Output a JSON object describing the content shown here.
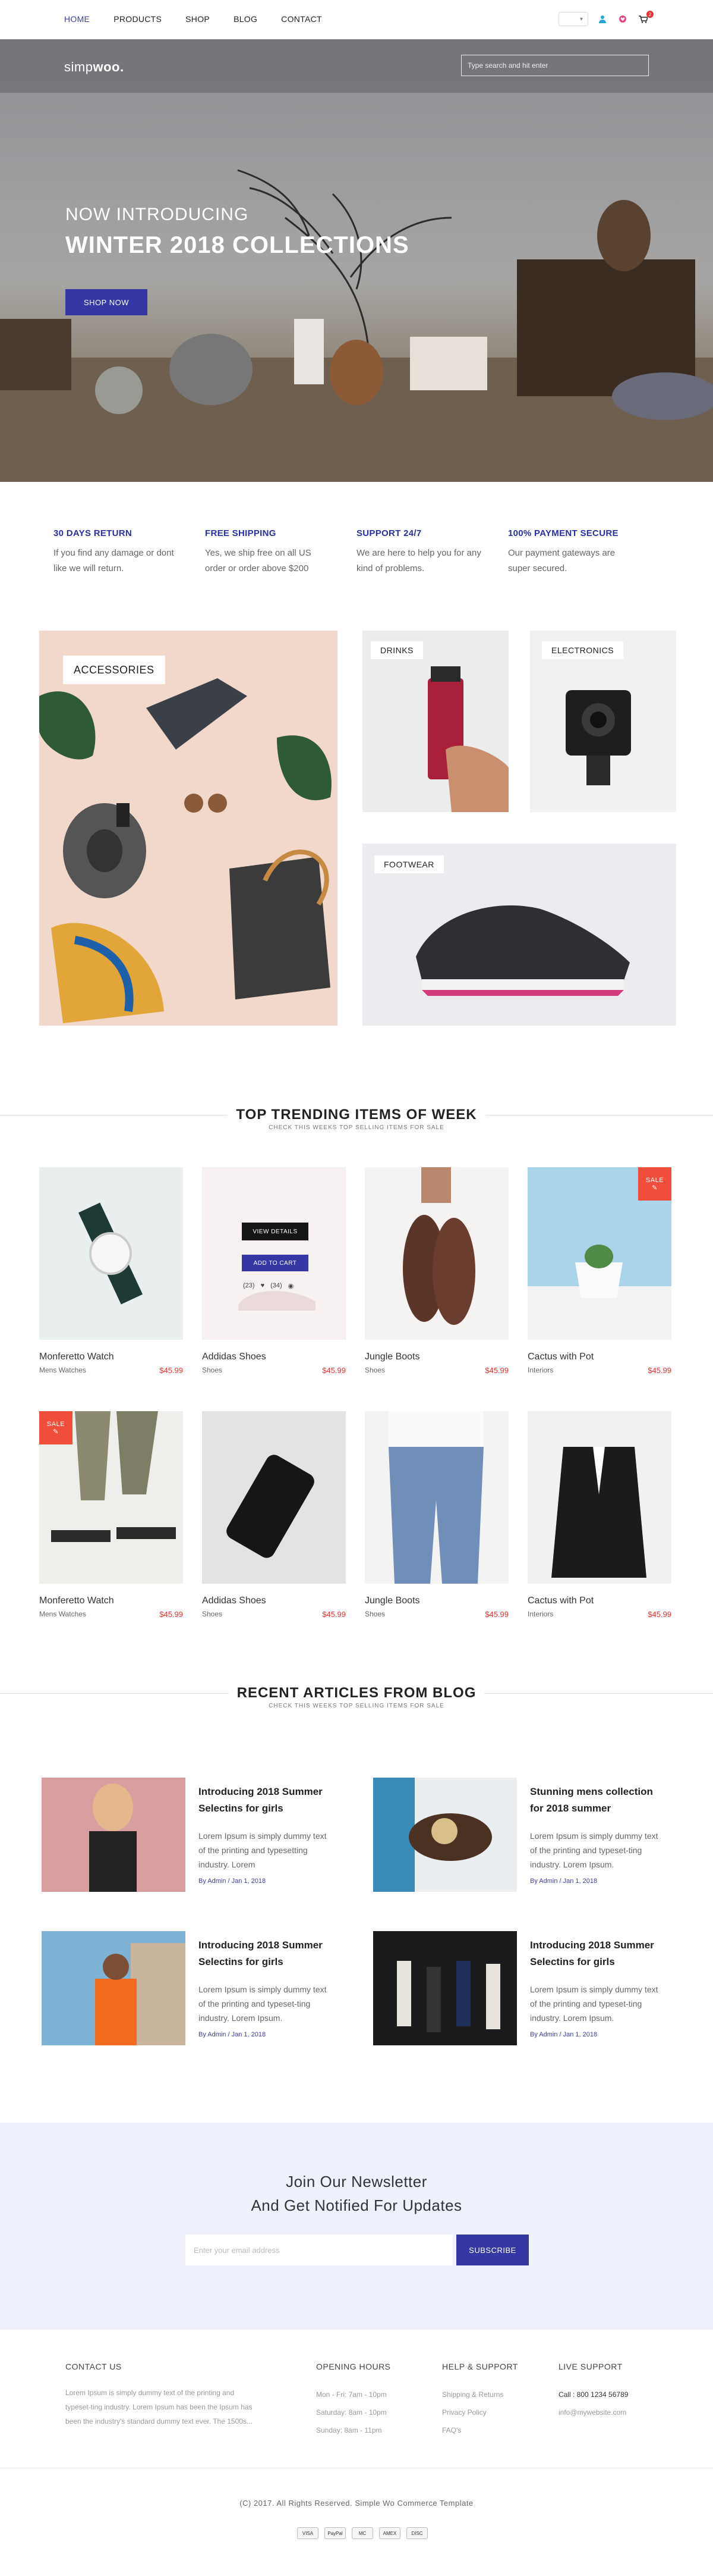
{
  "nav": {
    "items": [
      "HOME",
      "PRODUCTS",
      "SHOP",
      "BLOG",
      "CONTACT"
    ],
    "cart_count": "2"
  },
  "hero": {
    "logo_prefix": "simp",
    "logo_bold": "woo.",
    "search_placeholder": "Type search and hit enter",
    "kicker": "NOW INTRODUCING",
    "headline": "WINTER 2018 COLLECTIONS",
    "cta": "SHOP NOW"
  },
  "features": [
    {
      "title": "30 DAYS RETURN",
      "text": "If you find any damage or dont like we will return."
    },
    {
      "title": "FREE SHIPPING",
      "text": "Yes, we ship free on all US order or order above $200"
    },
    {
      "title": "SUPPORT 24/7",
      "text": "We are here to help you for any kind of problems."
    },
    {
      "title": "100% PAYMENT SECURE",
      "text": "Our payment gateways are super secured."
    }
  ],
  "categories": {
    "accessories": "ACCESSORIES",
    "drinks": "DRINKS",
    "electronics": "ELECTRONICS",
    "footwear": "FOOTWEAR"
  },
  "trending": {
    "title": "TOP TRENDING ITEMS OF WEEK",
    "subtitle": "CHECK THIS WEEKS TOP SELLING ITEMS FOR SALE",
    "view_details": "VIEW DETAILS",
    "add_to_cart": "ADD TO CART",
    "likes": "(23)",
    "views": "(34)",
    "sale_label": "SALE",
    "products": [
      {
        "name": "Monferetto Watch",
        "category": "Mens Watches",
        "price": "$45.99"
      },
      {
        "name": "Addidas Shoes",
        "category": "Shoes",
        "price": "$45.99"
      },
      {
        "name": "Jungle Boots",
        "category": "Shoes",
        "price": "$45.99"
      },
      {
        "name": "Cactus with Pot",
        "category": "Interiors",
        "price": "$45.99"
      },
      {
        "name": "Monferetto Watch",
        "category": "Mens Watches",
        "price": "$45.99"
      },
      {
        "name": "Addidas Shoes",
        "category": "Shoes",
        "price": "$45.99"
      },
      {
        "name": "Jungle Boots",
        "category": "Shoes",
        "price": "$45.99"
      },
      {
        "name": "Cactus with Pot",
        "category": "Interiors",
        "price": "$45.99"
      }
    ]
  },
  "blog": {
    "title": "RECENT ARTICLES FROM BLOG",
    "subtitle": "CHECK THIS WEEKS TOP SELLING ITEMS FOR SALE",
    "posts": [
      {
        "title": "Introducing 2018 Summer Selectins for girls",
        "text": "Lorem Ipsum is simply dummy text of the printing and typesetting industry. Lorem",
        "byline": "By Admin  /  Jan 1, 2018"
      },
      {
        "title": "Stunning mens collection for 2018 summer",
        "text": "Lorem Ipsum is simply dummy text of the printing and typeset-ting industry. Lorem Ipsum.",
        "byline": "By Admin  /  Jan 1, 2018"
      },
      {
        "title": "Introducing 2018 Summer Selectins for girls",
        "text": "Lorem Ipsum is simply dummy text of the printing and typeset-ting industry. Lorem Ipsum.",
        "byline": "By Admin  /  Jan 1, 2018"
      },
      {
        "title": "Introducing 2018 Summer Selectins for girls",
        "text": "Lorem Ipsum is simply dummy text of the printing and typeset-ting industry. Lorem Ipsum.",
        "byline": "By Admin  /  Jan 1, 2018"
      }
    ]
  },
  "newsletter": {
    "line1": "Join Our Newsletter",
    "line2": "And Get Notified For Updates",
    "placeholder": "Enter your email address",
    "button": "SUBSCRIBE"
  },
  "footer": {
    "contact_title": "CONTACT US",
    "contact_text": "Lorem Ipsum is simply dummy text of the printing and typeset-ting industry. Lorem Ipsum has been the Ipsum has been the industry's standard dummy text ever. The 1500s...",
    "hours_title": "OPENING HOURS",
    "hours": [
      "Mon - Fri: 7am - 10pm",
      "Saturday: 8am - 10pm",
      "Sunday: 8am - 11pm"
    ],
    "help_title": "HELP & SUPPORT",
    "help_links": [
      "Shipping & Returns",
      "Privacy Policy",
      "FAQ's"
    ],
    "live_title": "LIVE SUPPORT",
    "call": "Call : 800 1234 56789",
    "email": "info@mywebsite.com",
    "copyright": "(C) 2017. All Rights Reserved. Simple Wo Commerce Template",
    "payments": [
      "VISA",
      "PayPal",
      "MC",
      "AMEX",
      "DISC"
    ]
  },
  "colors": {
    "accent": "#3537a4",
    "sale": "#f04e3b",
    "price": "#e63333"
  }
}
